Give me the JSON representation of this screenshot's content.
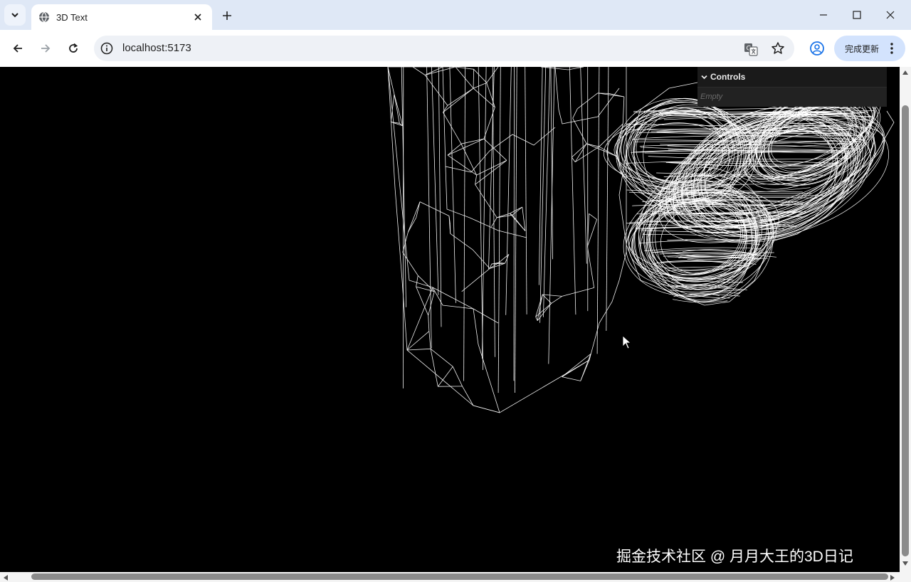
{
  "browser": {
    "tab_title": "3D Text",
    "address": "localhost:5173",
    "update_button_label": "完成更新"
  },
  "gui": {
    "title": "Controls",
    "empty_label": "Empty"
  },
  "watermark": "掘金技术社区 @ 月月大王的3D日记",
  "colors": {
    "tabstrip_bg": "#dfe8f6",
    "update_button_bg": "#d3e3fd",
    "scene_bg": "#000000",
    "wireframe": "#ffffff",
    "gui_bg": "#1a1a1a"
  }
}
